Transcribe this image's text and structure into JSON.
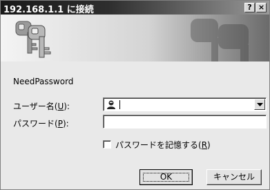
{
  "window": {
    "title": "192.168.1.1 に接続",
    "help_label": "?",
    "close_label": "×"
  },
  "dialog": {
    "realm": "NeedPassword",
    "username_label_prefix": "ユーザー名(",
    "username_label_key": "U",
    "username_label_suffix": "):",
    "username_value": "",
    "password_label_prefix": "パスワード(",
    "password_label_key": "P",
    "password_label_suffix": "):",
    "password_value": "",
    "remember_prefix": "パスワードを記憶する(",
    "remember_key": "R",
    "remember_suffix": ")",
    "remember_checked": false,
    "ok_label": "OK",
    "cancel_label": "キャンセル"
  },
  "icons": {
    "banner": "keys-icon",
    "user": "user-icon",
    "dropdown": "chevron-down-icon"
  }
}
